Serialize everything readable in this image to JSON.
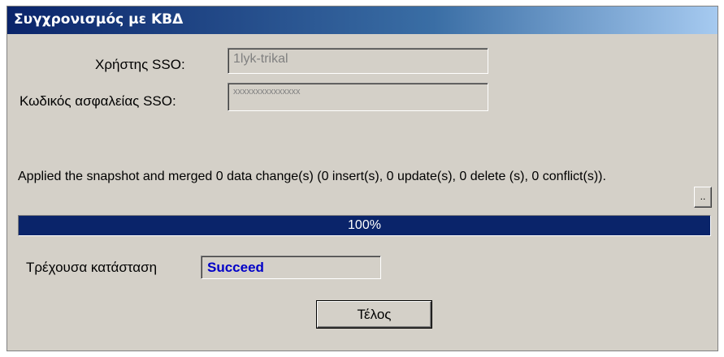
{
  "window": {
    "title": "Συγχρονισμός με ΚΒΔ"
  },
  "form": {
    "user_label": "Χρήστης SSO:",
    "user_value": "1lyk-trikal",
    "password_label": "Κωδικός ασφαλείας SSO:",
    "password_value": "xxxxxxxxxxxxxxx"
  },
  "message": "Applied the snapshot and merged 0 data change(s) (0 insert(s), 0 update(s), 0 delete (s), 0 conflict(s)).",
  "details_button": "..",
  "progress": {
    "percent": 100,
    "text": "100%"
  },
  "status": {
    "label": "Τρέχουσα κατάσταση",
    "value": "Succeed"
  },
  "finish_button": "Τέλος",
  "colors": {
    "title_bar": "#0a246a",
    "window_bg": "#d4d0c8",
    "progress_fill": "#0a246a",
    "status_text": "#0000c8"
  }
}
